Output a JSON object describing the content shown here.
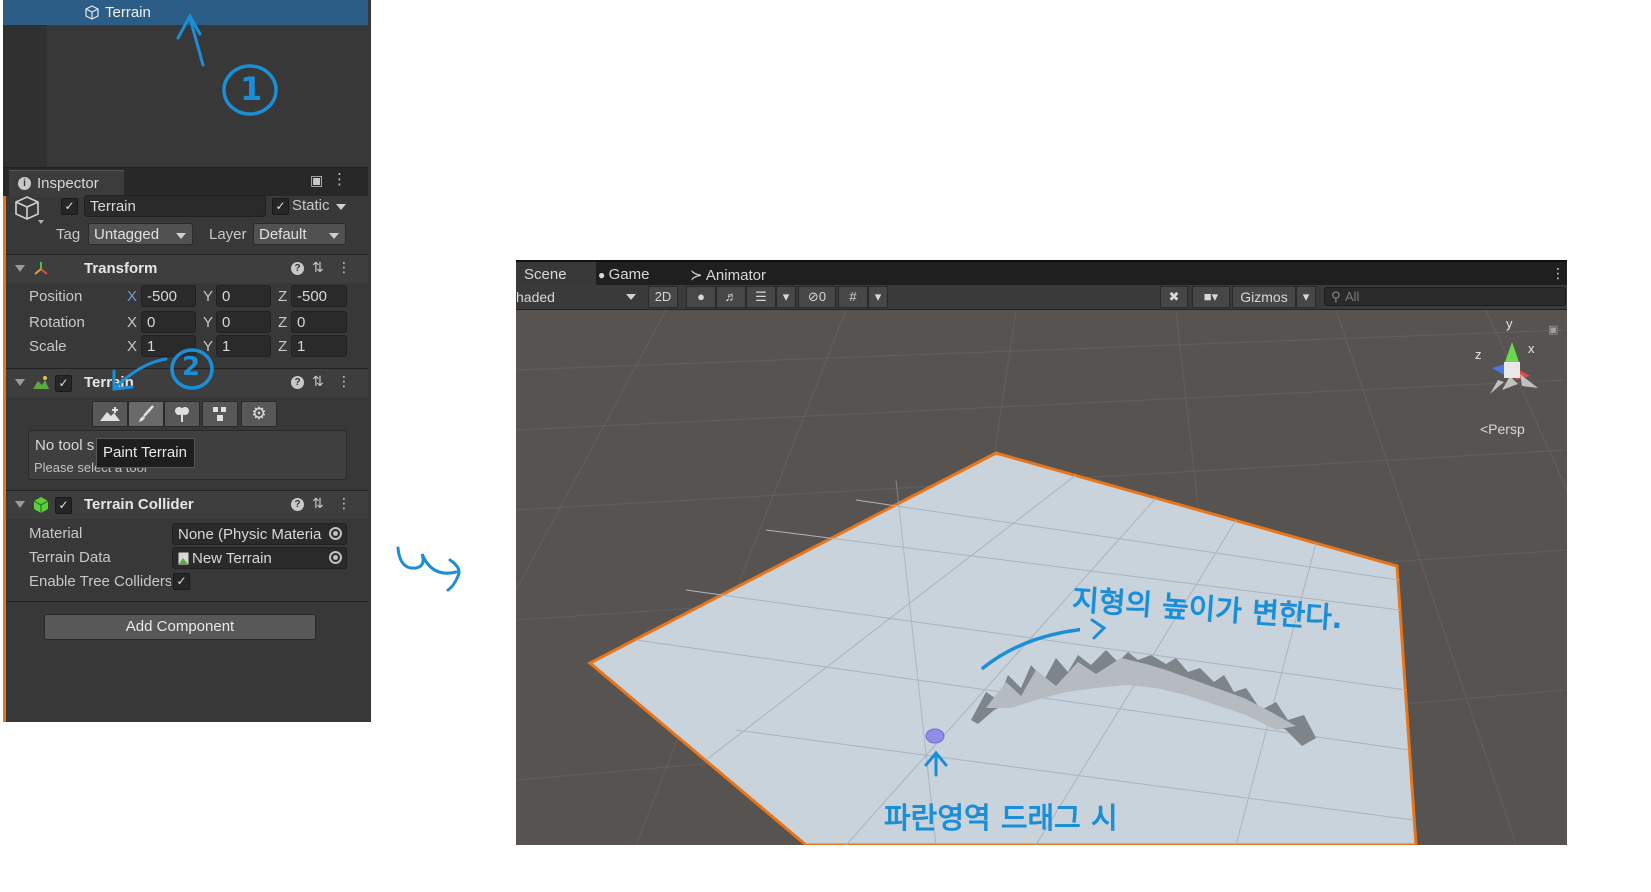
{
  "hierarchy": {
    "selected_item": "Terrain"
  },
  "inspector": {
    "tab_label": "Inspector",
    "object_name": "Terrain",
    "static_label": "Static",
    "tag_label": "Tag",
    "tag_value": "Untagged",
    "layer_label": "Layer",
    "layer_value": "Default"
  },
  "transform": {
    "title": "Transform",
    "rows": [
      {
        "label": "Position",
        "x": "-500",
        "y": "0",
        "z": "-500"
      },
      {
        "label": "Rotation",
        "x": "0",
        "y": "0",
        "z": "0"
      },
      {
        "label": "Scale",
        "x": "1",
        "y": "1",
        "z": "1"
      }
    ],
    "axis_x": "X",
    "axis_y": "Y",
    "axis_z": "Z"
  },
  "terrain_component": {
    "title": "Terrain",
    "tools": [
      "create-neighbor-terrains",
      "paint-terrain",
      "paint-trees",
      "paint-details",
      "terrain-settings"
    ],
    "no_tool_text": "No tool s",
    "hint_text": "Please select a tool",
    "tooltip": "Paint Terrain"
  },
  "terrain_collider": {
    "title": "Terrain Collider",
    "material_label": "Material",
    "material_value": "None (Physic Materia",
    "terrain_data_label": "Terrain Data",
    "terrain_data_value": "New Terrain",
    "enable_tree_label": "Enable Tree Colliders"
  },
  "add_component_label": "Add Component",
  "scene_view": {
    "tabs": [
      "Scene",
      "Game",
      "Animator"
    ],
    "shading": "haded",
    "mode_2d": "2D",
    "hidden_count": "0",
    "gizmos_label": "Gizmos",
    "search_placeholder": "All",
    "gizmo_axes": {
      "y": "y",
      "z": "z",
      "x": "x"
    },
    "projection_label": "<Persp"
  },
  "annotations": {
    "step1": "1",
    "step2": "2",
    "height_changes": "지형의 높이가 변한다.",
    "drag_blue": "파란영역 드래그 시"
  },
  "colors": {
    "accent_orange": "#e8751a",
    "selection_blue": "#2c5d87",
    "annotation_blue": "#1a8fd8",
    "terrain_fill": "#c9d3dc"
  }
}
